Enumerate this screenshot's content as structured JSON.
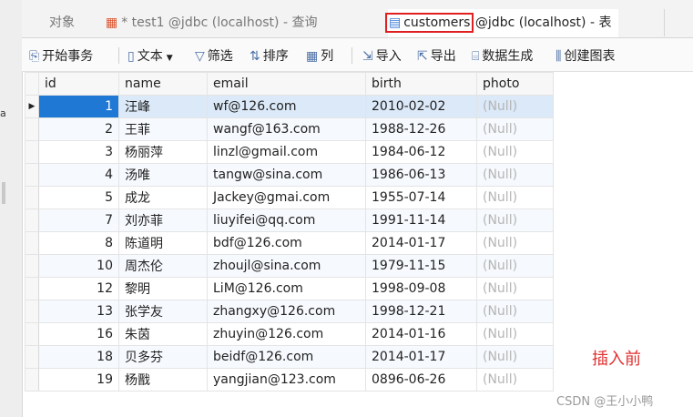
{
  "tabs": {
    "objects": "对象",
    "query": "* test1 @jdbc (localhost) - 查询",
    "active_name": "customers",
    "active_suffix": " @jdbc (localhost) - 表"
  },
  "toolbar": {
    "begin_transaction": "开始事务",
    "text": "文本",
    "filter": "筛选",
    "sort": "排序",
    "columns": "列",
    "import": "导入",
    "export": "导出",
    "data_generation": "数据生成",
    "create_chart": "创建图表"
  },
  "table": {
    "columns": [
      "id",
      "name",
      "email",
      "birth",
      "photo"
    ],
    "rows": [
      [
        "1",
        "汪峰",
        "wf@126.com",
        "2010-02-02",
        "(Null)"
      ],
      [
        "2",
        "王菲",
        "wangf@163.com",
        "1988-12-26",
        "(Null)"
      ],
      [
        "3",
        "杨丽萍",
        "linzl@gmail.com",
        "1984-06-12",
        "(Null)"
      ],
      [
        "4",
        "汤唯",
        "tangw@sina.com",
        "1986-06-13",
        "(Null)"
      ],
      [
        "5",
        "成龙",
        "Jackey@gmai.com",
        "1955-07-14",
        "(Null)"
      ],
      [
        "7",
        "刘亦菲",
        "liuyifei@qq.com",
        "1991-11-14",
        "(Null)"
      ],
      [
        "8",
        "陈道明",
        "bdf@126.com",
        "2014-01-17",
        "(Null)"
      ],
      [
        "10",
        "周杰伦",
        "zhoujl@sina.com",
        "1979-11-15",
        "(Null)"
      ],
      [
        "12",
        "黎明",
        "LiM@126.com",
        "1998-09-08",
        "(Null)"
      ],
      [
        "13",
        "张学友",
        "zhangxy@126.com",
        "1998-12-21",
        "(Null)"
      ],
      [
        "16",
        "朱茵",
        "zhuyin@126.com",
        "2014-01-16",
        "(Null)"
      ],
      [
        "18",
        "贝多芬",
        "beidf@126.com",
        "2014-01-17",
        "(Null)"
      ],
      [
        "19",
        "杨戬",
        "yangjian@123.com",
        "0896-06-26",
        "(Null)"
      ]
    ]
  },
  "annotation": "插入前",
  "watermark": "CSDN @王小小鸭",
  "left_strip_glyph": "a",
  "colors": {
    "selection": "#1e78d4",
    "highlight_box": "#e02020",
    "annotation": "#e03030"
  }
}
